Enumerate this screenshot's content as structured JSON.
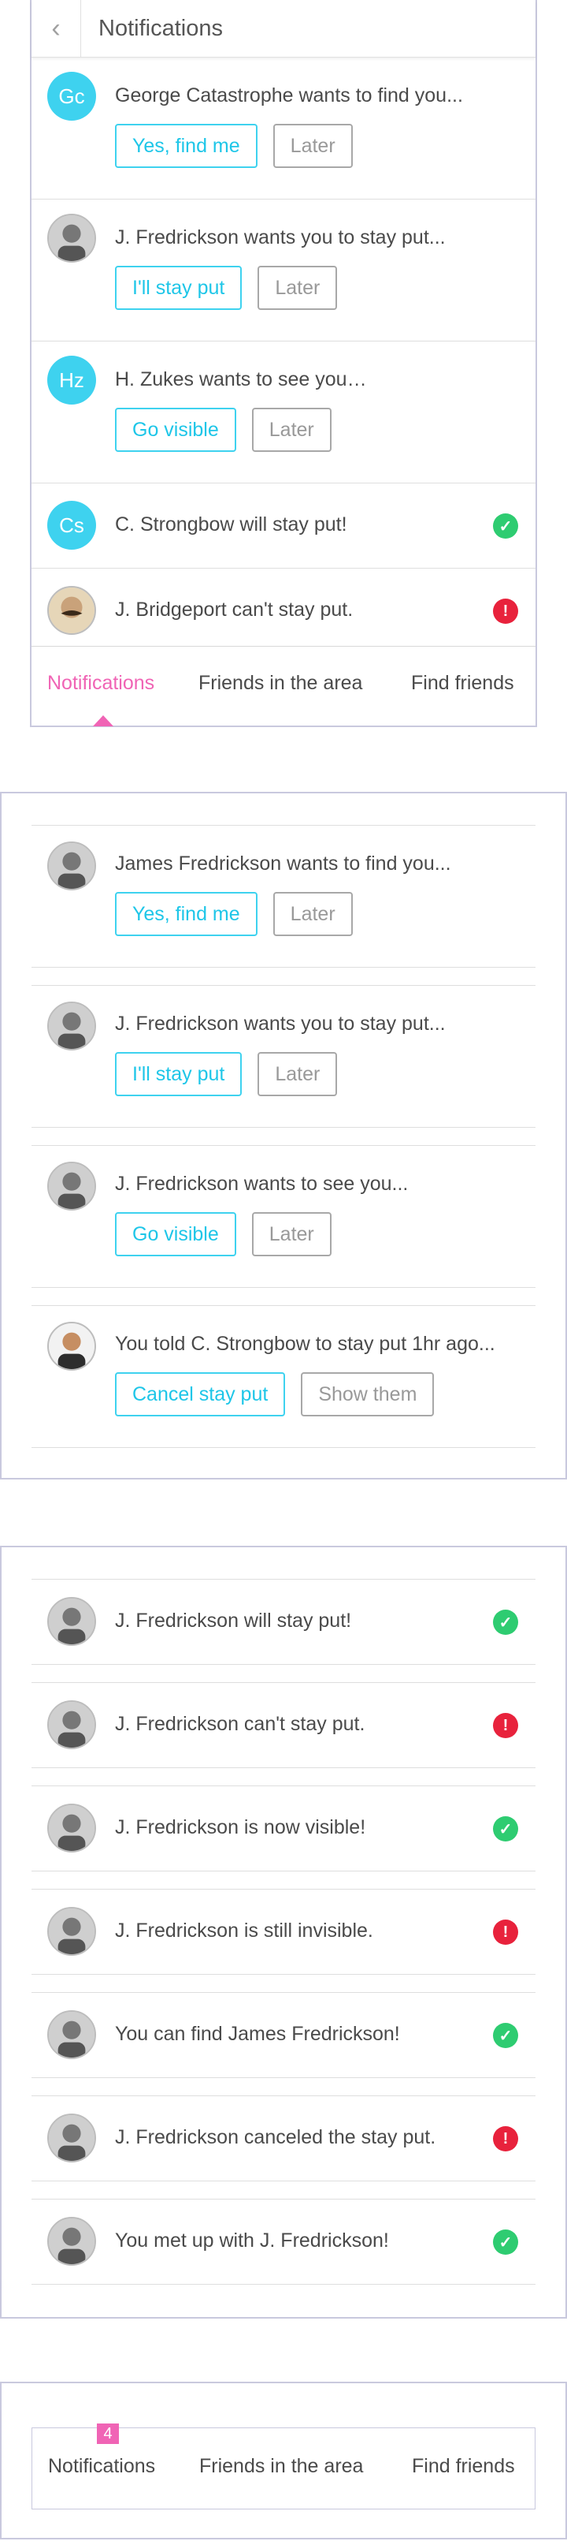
{
  "panel1": {
    "header": {
      "title": "Notifications"
    },
    "notifications": [
      {
        "avatar": "Gc",
        "type": "initials",
        "text": "George Catastrophe wants to find you...",
        "primary": "Yes, find me",
        "secondary": "Later"
      },
      {
        "avatar": "person-photo",
        "type": "photo",
        "text": "J. Fredrickson wants you to stay put...",
        "primary": "I'll stay put",
        "secondary": "Later"
      },
      {
        "avatar": "Hz",
        "type": "initials",
        "text": "H. Zukes wants to see you…",
        "primary": "Go visible",
        "secondary": "Later"
      },
      {
        "avatar": "Cs",
        "type": "initials",
        "text": "C. Strongbow will stay put!",
        "status": "ok"
      },
      {
        "avatar": "mustache-photo",
        "type": "photo",
        "text": "J. Bridgeport can't stay put.",
        "status": "error"
      }
    ],
    "tabs": {
      "notifications": "Notifications",
      "friends": "Friends in the area",
      "find": "Find friends"
    }
  },
  "panel2": {
    "notifications": [
      {
        "text": "James Fredrickson wants to find you...",
        "primary": "Yes, find me",
        "secondary": "Later"
      },
      {
        "text": "J. Fredrickson wants you to stay put...",
        "primary": "I'll stay put",
        "secondary": "Later"
      },
      {
        "text": "J. Fredrickson wants to see you...",
        "primary": "Go visible",
        "secondary": "Later"
      },
      {
        "text": "You told C. Strongbow to stay put 1hr ago...",
        "primary": "Cancel stay put",
        "secondary": "Show them"
      }
    ]
  },
  "panel3": {
    "notifications": [
      {
        "text": "J. Fredrickson will stay put!",
        "status": "ok"
      },
      {
        "text": "J. Fredrickson can't stay put.",
        "status": "error"
      },
      {
        "text": "J. Fredrickson is now visible!",
        "status": "ok"
      },
      {
        "text": "J. Fredrickson is still invisible.",
        "status": "error"
      },
      {
        "text": "You can find James Fredrickson!",
        "status": "ok"
      },
      {
        "text": "J. Fredrickson canceled the stay put.",
        "status": "error"
      },
      {
        "text": "You met up with J. Fredrickson!",
        "status": "ok"
      }
    ]
  },
  "panel4": {
    "badge": "4",
    "tabs": {
      "notifications": "Notifications",
      "friends": "Friends in the area",
      "find": "Find friends"
    }
  },
  "colors": {
    "accent": "#3ed2ef",
    "active_tab": "#f064b5",
    "ok": "#2ecc71",
    "error": "#e8223c"
  },
  "icons": {
    "back": "chevron-left-icon",
    "ok": "check-circle-icon",
    "error": "exclamation-circle-icon"
  }
}
